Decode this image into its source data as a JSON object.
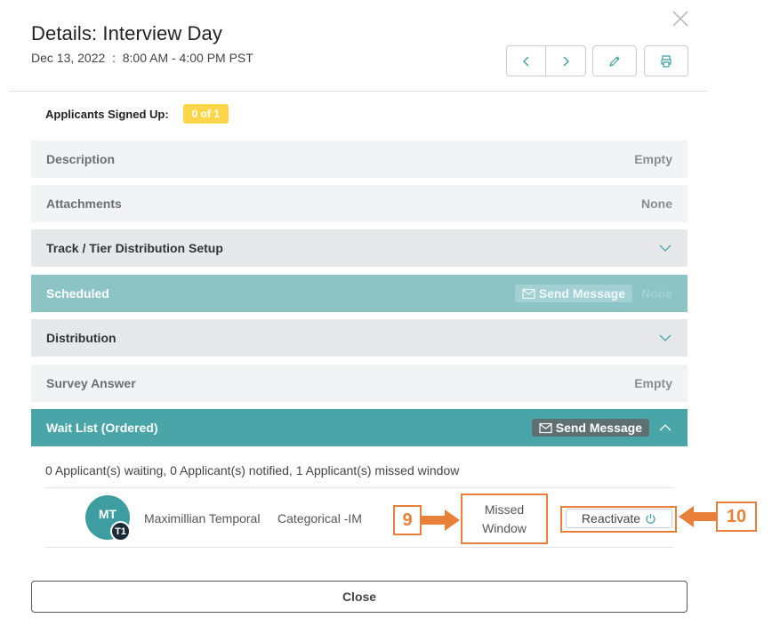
{
  "dialog": {
    "title": "Details: Interview Day",
    "date": "Dec 13, 2022",
    "separator": ":",
    "time": "8:00 AM - 4:00 PM PST"
  },
  "toolbar": {
    "icons": [
      "chevron-left-icon",
      "chevron-right-icon",
      "pencil-icon",
      "printer-icon"
    ]
  },
  "signed_up": {
    "label": "Applicants Signed Up:",
    "count": "0 of 1",
    "badge_color": "#ffd54a"
  },
  "rows": {
    "description": {
      "label": "Description",
      "value": "Empty"
    },
    "attachments": {
      "label": "Attachments",
      "value": "None"
    },
    "track_tier": {
      "label": "Track / Tier Distribution Setup"
    },
    "scheduled": {
      "label": "Scheduled",
      "send_message": "Send Message",
      "value": "None"
    },
    "distribution": {
      "label": "Distribution"
    },
    "survey_answer": {
      "label": "Survey Answer",
      "value": "Empty"
    },
    "wait_list": {
      "label": "Wait List (Ordered)",
      "send_message": "Send Message"
    }
  },
  "wait_list": {
    "summary": "0 Applicant(s) waiting, 0 Applicant(s) notified, 1 Applicant(s) missed window",
    "applicant": {
      "initials": "MT",
      "tier": "T1",
      "name": "Maximillian Temporal",
      "track": "Categorical -IM",
      "status_line1": "Missed",
      "status_line2": "Window",
      "action": "Reactivate"
    }
  },
  "callouts": {
    "left": "9",
    "right": "10",
    "color": "#e8803a"
  },
  "colors": {
    "scheduled_bar": "#8cc4c6",
    "wait_bar": "#4aa5a8",
    "avatar": "#3e9da0"
  },
  "footer": {
    "close_label": "Close"
  }
}
